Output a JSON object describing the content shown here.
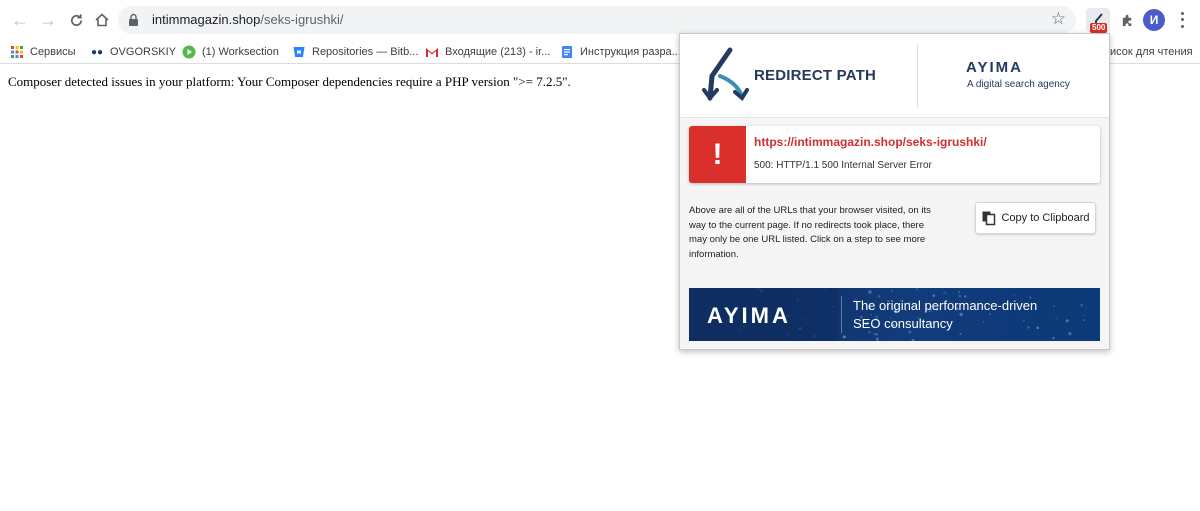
{
  "browser": {
    "url_domain": "intimmagazin.shop",
    "url_path": "/seks-igrushki/",
    "redirect_badge": "500",
    "avatar_letter": "И"
  },
  "bookmarks": [
    {
      "label": "Сервисы",
      "icon": "apps-grid-icon",
      "color": "#ea4335"
    },
    {
      "label": "OVGORSKIY",
      "icon": "ovgorskiy-icon",
      "color": "#1a3a6b"
    },
    {
      "label": "(1) Worksection",
      "icon": "play-circle-icon",
      "color": "#55b84a"
    },
    {
      "label": "Repositories — Bitb...",
      "icon": "bitbucket-icon",
      "color": "#2684ff"
    },
    {
      "label": "Входящие (213) - ir...",
      "icon": "gmail-icon",
      "color": "#d93025"
    },
    {
      "label": "Инструкция разра...",
      "icon": "docs-icon",
      "color": "#4285f4"
    },
    {
      "label": "исок для чтения",
      "icon": "reading-list-icon",
      "color": "#5f6368"
    }
  ],
  "page": {
    "message": "Composer detected issues in your platform: Your Composer dependencies require a PHP version \">= 7.2.5\"."
  },
  "popup": {
    "title": "REDIRECT PATH",
    "ayima_wordmark": "AYIMA",
    "ayima_tagline": "A digital search agency",
    "result": {
      "url": "https://intimmagazin.shop/seks-igrushki/",
      "status": "500: HTTP/1.1 500 Internal Server Error",
      "error_symbol": "!"
    },
    "info_text": "Above are all of the URLs that your browser visited, on its way to the current page. If no redirects took place, there may only be one URL listed. Click on a step to see more information.",
    "copy_label": "Copy to Clipboard",
    "banner": {
      "wordmark": "AYIMA",
      "line1": "The original performance-driven",
      "line2": "SEO consultancy"
    }
  },
  "colors": {
    "error_red": "#d9302c",
    "brand_navy": "#243a5e",
    "banner_blue": "#123b7a"
  }
}
